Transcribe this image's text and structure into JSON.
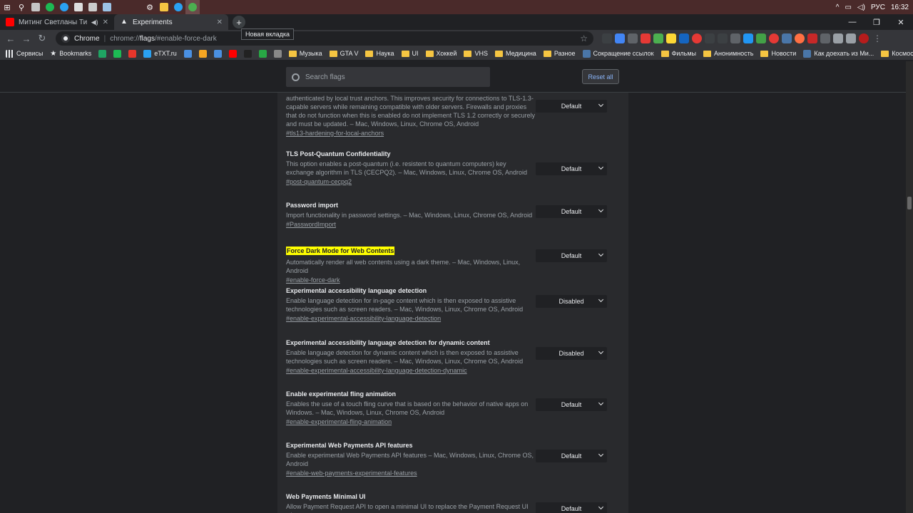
{
  "taskbar": {
    "lang": "РУС",
    "time": "16:32"
  },
  "tabs": [
    {
      "title": "Митинг Светланы Тихановс",
      "favicon_color": "#ff0000"
    },
    {
      "title": "Experiments",
      "favicon_color": "#e8eaed"
    }
  ],
  "tooltip": "Новая вкладка",
  "omnibox": {
    "site": "Chrome",
    "scheme": "chrome://",
    "host": "flags",
    "path": "/#enable-force-dark"
  },
  "bookmarks": [
    {
      "label": "Сервисы",
      "kind": "apps"
    },
    {
      "label": "Bookmarks",
      "kind": "star"
    },
    {
      "label": "",
      "kind": "icon",
      "color": "#1fa463"
    },
    {
      "label": "",
      "kind": "icon",
      "color": "#1db954"
    },
    {
      "label": "",
      "kind": "icon",
      "color": "#e8362b"
    },
    {
      "label": "eTXT.ru",
      "kind": "icon",
      "color": "#2aa1f2"
    },
    {
      "label": "",
      "kind": "icon",
      "color": "#4a90e2"
    },
    {
      "label": "",
      "kind": "icon",
      "color": "#f5a623"
    },
    {
      "label": "",
      "kind": "icon",
      "color": "#4a90e2"
    },
    {
      "label": "",
      "kind": "icon",
      "color": "#ff0000"
    },
    {
      "label": "",
      "kind": "icon",
      "color": "#222222"
    },
    {
      "label": "",
      "kind": "icon",
      "color": "#28a745"
    },
    {
      "label": "",
      "kind": "icon",
      "color": "#888888"
    },
    {
      "label": "Музыка",
      "kind": "folder"
    },
    {
      "label": "GTA V",
      "kind": "folder"
    },
    {
      "label": "Наука",
      "kind": "folder"
    },
    {
      "label": "UI",
      "kind": "folder"
    },
    {
      "label": "Хоккей",
      "kind": "folder"
    },
    {
      "label": "VHS",
      "kind": "folder"
    },
    {
      "label": "Медицина",
      "kind": "folder"
    },
    {
      "label": "Разное",
      "kind": "folder"
    },
    {
      "label": "Сокращение ссылок",
      "kind": "icon",
      "color": "#4a76a8"
    },
    {
      "label": "Фильмы",
      "kind": "folder"
    },
    {
      "label": "Анонимность",
      "kind": "folder"
    },
    {
      "label": "Новости",
      "kind": "folder"
    },
    {
      "label": "Как доехать из Ми...",
      "kind": "icon",
      "color": "#4a76a8"
    },
    {
      "label": "Космос",
      "kind": "folder"
    }
  ],
  "flags_header": {
    "search_placeholder": "Search flags",
    "reset_label": "Reset all"
  },
  "flags": [
    {
      "name": "",
      "desc": "authenticated by local trust anchors. This improves security for connections to TLS-1.3-capable servers while remaining compatible with older servers. Firewalls and proxies that do not function when this is enabled do not implement TLS 1.2 correctly or securely and must be updated. – Mac, Windows, Linux, Chrome OS, Android",
      "link": "#tls13-hardening-for-local-anchors",
      "value": "Default"
    },
    {
      "name": "TLS Post-Quantum Confidentiality",
      "desc": "This option enables a post-quantum (i.e. resistent to quantum computers) key exchange algorithm in TLS (CECPQ2). – Mac, Windows, Linux, Chrome OS, Android",
      "link": "#post-quantum-cecpq2",
      "value": "Default"
    },
    {
      "name": "Password import",
      "desc": "Import functionality in password settings. – Mac, Windows, Linux, Chrome OS, Android",
      "link": "#PasswordImport",
      "value": "Default"
    },
    {
      "name": "Force Dark Mode for Web Contents",
      "desc": "Automatically render all web contents using a dark theme. – Mac, Windows, Linux, Android",
      "link": "#enable-force-dark",
      "value": "Default",
      "highlight": true
    },
    {
      "name": "Experimental accessibility language detection",
      "desc": "Enable language detection for in-page content which is then exposed to assistive technologies such as screen readers. – Mac, Windows, Linux, Chrome OS, Android",
      "link": "#enable-experimental-accessibility-language-detection",
      "value": "Disabled"
    },
    {
      "name": "Experimental accessibility language detection for dynamic content",
      "desc": "Enable language detection for dynamic content which is then exposed to assistive technologies such as screen readers. – Mac, Windows, Linux, Chrome OS, Android",
      "link": "#enable-experimental-accessibility-language-detection-dynamic",
      "value": "Disabled"
    },
    {
      "name": "Enable experimental fling animation",
      "desc": "Enables the use of a touch fling curve that is based on the behavior of native apps on Windows. – Mac, Windows, Linux, Chrome OS, Android",
      "link": "#enable-experimental-fling-animation",
      "value": "Default"
    },
    {
      "name": "Experimental Web Payments API features",
      "desc": "Enable experimental Web Payments API features – Mac, Windows, Linux, Chrome OS, Android",
      "link": "#enable-web-payments-experimental-features",
      "value": "Default"
    },
    {
      "name": "Web Payments Minimal UI",
      "desc": "Allow Payment Request API to open a minimal UI to replace the Payment Request UI when",
      "link": "",
      "value": "Default"
    }
  ]
}
